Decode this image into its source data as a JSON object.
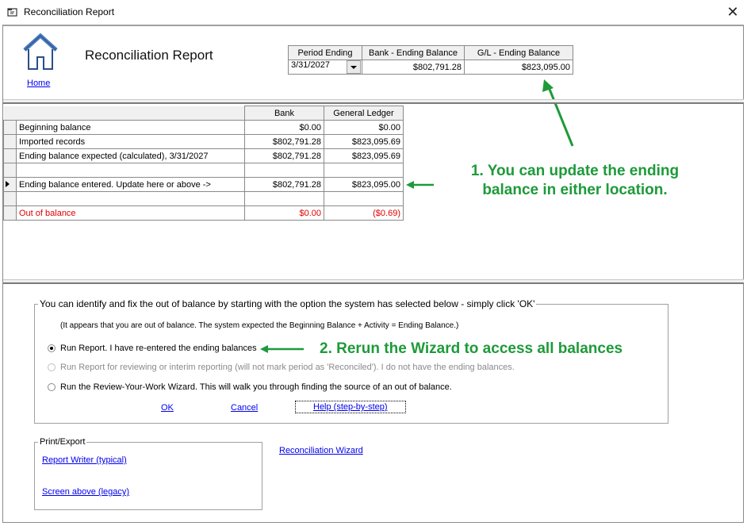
{
  "window": {
    "title": "Reconciliation Report",
    "close_label": "✕"
  },
  "header": {
    "home_icon": "house-icon",
    "home_label": "Home",
    "report_title": "Reconciliation Report",
    "period_table": {
      "columns": [
        "Period Ending",
        "Bank - Ending Balance",
        "G/L - Ending Balance"
      ],
      "period_ending": "3/31/2027",
      "bank_ending_balance": "$802,791.28",
      "gl_ending_balance": "$823,095.00"
    }
  },
  "grid": {
    "columns": [
      "",
      "Bank",
      "General Ledger"
    ],
    "rows": [
      {
        "label": "Beginning balance",
        "bank": "$0.00",
        "gl": "$0.00",
        "current": false,
        "red": false
      },
      {
        "label": "Imported records",
        "bank": "$802,791.28",
        "gl": "$823,095.69",
        "current": false,
        "red": false
      },
      {
        "label": "Ending balance expected (calculated), 3/31/2027",
        "bank": "$802,791.28",
        "gl": "$823,095.69",
        "current": false,
        "red": false
      },
      {
        "label": "",
        "bank": "",
        "gl": "",
        "current": false,
        "red": false
      },
      {
        "label": "Ending balance entered. Update here or above ->",
        "bank": "$802,791.28",
        "gl": "$823,095.00",
        "current": true,
        "red": false
      },
      {
        "label": "",
        "bank": "",
        "gl": "",
        "current": false,
        "red": false
      },
      {
        "label": "Out of balance",
        "bank": "$0.00",
        "gl": "($0.69)",
        "current": false,
        "red": true
      }
    ]
  },
  "annotations": {
    "note1_line1": "1. You can update the ending",
    "note1_line2": "balance in either location.",
    "note2": "2. Rerun the Wizard to access all balances",
    "color": "#1e9a3a"
  },
  "options_group": {
    "legend": "You can identify and fix the out of balance by starting with the option the system has selected below - simply click 'OK'",
    "info": "(It appears that you are out of balance.  The system expected the Beginning Balance + Activity = Ending Balance.)",
    "radios": [
      {
        "label": "Run Report. I have re-entered the ending balances",
        "selected": true,
        "enabled": true
      },
      {
        "label": "Run Report for reviewing or interim reporting (will not mark period as 'Reconciled'). I do not have the ending balances.",
        "selected": false,
        "enabled": false
      },
      {
        "label": "Run the Review-Your-Work Wizard.  This will walk you through finding the source of an out of balance.",
        "selected": false,
        "enabled": true
      }
    ],
    "ok_label": "OK",
    "cancel_label": "Cancel",
    "help_label": "Help (step-by-step)"
  },
  "print_export": {
    "legend": "Print/Export",
    "report_writer_label": "Report Writer (typical)",
    "screen_above_label": "Screen above (legacy)"
  },
  "reconciliation_wizard_label": "Reconciliation Wizard"
}
